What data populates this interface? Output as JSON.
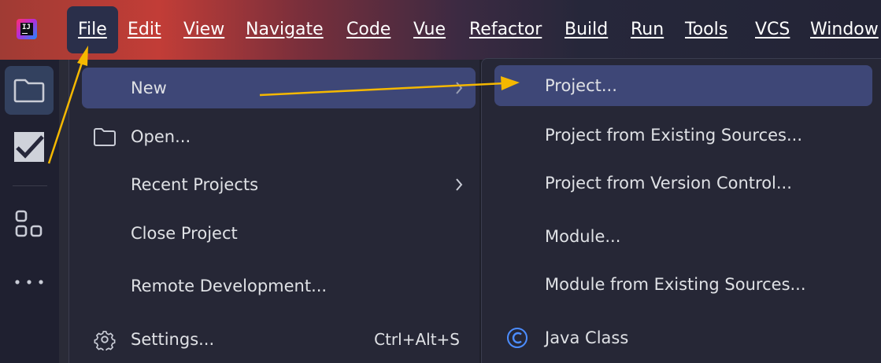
{
  "menubar": {
    "items": [
      {
        "label": "File"
      },
      {
        "label": "Edit"
      },
      {
        "label": "View"
      },
      {
        "label": "Navigate"
      },
      {
        "label": "Code"
      },
      {
        "label": "Vue"
      },
      {
        "label": "Refactor"
      },
      {
        "label": "Build"
      },
      {
        "label": "Run"
      },
      {
        "label": "Tools"
      },
      {
        "label": "VCS"
      },
      {
        "label": "Window"
      }
    ],
    "active_index": 0,
    "logo_text": "IJ"
  },
  "left_toolbar": {
    "buttons": [
      {
        "icon": "folder-icon",
        "active": true
      },
      {
        "icon": "checkbox-icon",
        "active": false
      },
      {
        "icon": "structure-icon",
        "active": false
      },
      {
        "icon": "more-icon",
        "active": false
      }
    ]
  },
  "file_menu": {
    "items": [
      {
        "label": "New",
        "submenu": true,
        "selected": true
      },
      {
        "label": "Open...",
        "icon": "folder-icon"
      },
      {
        "label": "Recent Projects",
        "submenu": true
      },
      {
        "label": "Close Project"
      },
      {
        "label": "Remote Development..."
      },
      {
        "label": "Settings...",
        "icon": "gear-icon",
        "shortcut": "Ctrl+Alt+S"
      }
    ]
  },
  "new_menu": {
    "items": [
      {
        "label": "Project...",
        "selected": true
      },
      {
        "label": "Project from Existing Sources..."
      },
      {
        "label": "Project from Version Control..."
      },
      {
        "label": "Module..."
      },
      {
        "label": "Module from Existing Sources..."
      },
      {
        "label": "Java Class",
        "icon": "java-class-icon"
      }
    ]
  },
  "colors": {
    "accent_selection": "#3e4777",
    "menu_background": "#262736",
    "annotation_arrow": "#f5b800"
  }
}
